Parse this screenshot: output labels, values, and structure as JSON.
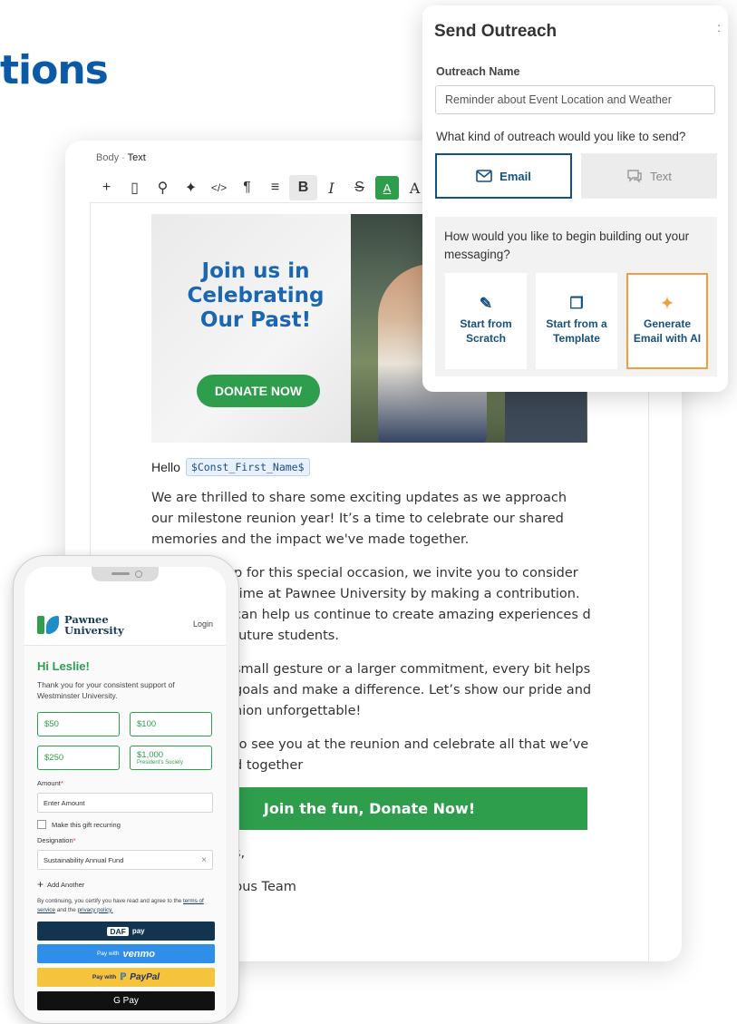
{
  "headline": "tions",
  "editor": {
    "breadcrumb_parent": "Body",
    "breadcrumb_sep": "-",
    "breadcrumb_current": "Text",
    "toolbar_icons": [
      "add-icon",
      "mobile-icon",
      "link-icon",
      "sparkle-icon",
      "code-icon",
      "paragraph-icon",
      "align-icon",
      "bold-icon",
      "italic-icon",
      "strikethrough-icon",
      "text-color-icon",
      "font-icon"
    ],
    "toolbar_glyphs": {
      "add": "+",
      "mobile": "▯",
      "link": "⚲",
      "sparkle": "✦",
      "code": "</>",
      "paragraph": "¶",
      "align": "≡",
      "bold": "B",
      "italic": "I",
      "strike": "S",
      "textcolor": "A",
      "font": "A"
    },
    "banner": {
      "title": "Join us in Celebrating Our Past!",
      "button": "DONATE NOW"
    },
    "greeting": "Hello",
    "merge_tag": "$Const_First_Name$",
    "paragraphs": [
      "We are thrilled to share some exciting updates as we approach our milestone reunion year! It’s a time to celebrate our shared memories and the impact we've made together.",
      "p for this special occasion, we invite you to consider time at Pawnee University by making a contribution. can help us continue to create amazing experiences d future students.",
      "small gesture or a larger commitment, every bit helps goals and make a difference. Let’s show our pride and nion unforgettable!",
      "to see you at the reunion and celebrate all that we’ve d together"
    ],
    "cta": "Join the fun, Donate Now!",
    "closing_1": "s,",
    "closing_2": "pus Team"
  },
  "outreach": {
    "title": "Send Outreach",
    "close": ":",
    "name_label": "Outreach Name",
    "name_value": "Reminder about Event Location and Weather",
    "type_question": "What kind of outreach would you like to send?",
    "email_label": "Email",
    "text_label": "Text",
    "build_question": "How would you like to begin building out your messaging?",
    "options": {
      "scratch": "Start from Scratch",
      "template": "Start from a Template",
      "ai": "Generate Email with AI"
    },
    "accent_color": "#f0a03a",
    "selected_color": "#15517f"
  },
  "phone": {
    "logo_line1": "Pawnee",
    "logo_line2": "University",
    "login": "Login",
    "hi": "Hi Leslie!",
    "thanks": "Thank you for your consistent support of Westminster University.",
    "amounts": [
      "$50",
      "$100",
      "$250",
      "$1,000"
    ],
    "amount_note": "President's Society",
    "amount_label": "Amount",
    "amount_placeholder": "Enter Amount",
    "recurring": "Make this gift recurring",
    "designation_label": "Designation",
    "designation_value": "Sustainability Annual Fund",
    "clear": "×",
    "add_another": "Add Another",
    "terms_prefix": "By continuing, you certify you have read and agree to the",
    "terms_link": "terms of service",
    "terms_mid": "and the",
    "privacy_link": "privacy policy.",
    "daf_tag": "DAF",
    "daf_text": "pay",
    "venmo_prefix": "Pay with",
    "venmo_brand": "venmo",
    "paypal_prefix": "Pay with",
    "paypal_brand": "PayPal",
    "gpay": "G Pay",
    "brand_green": "#2e9e4d"
  }
}
